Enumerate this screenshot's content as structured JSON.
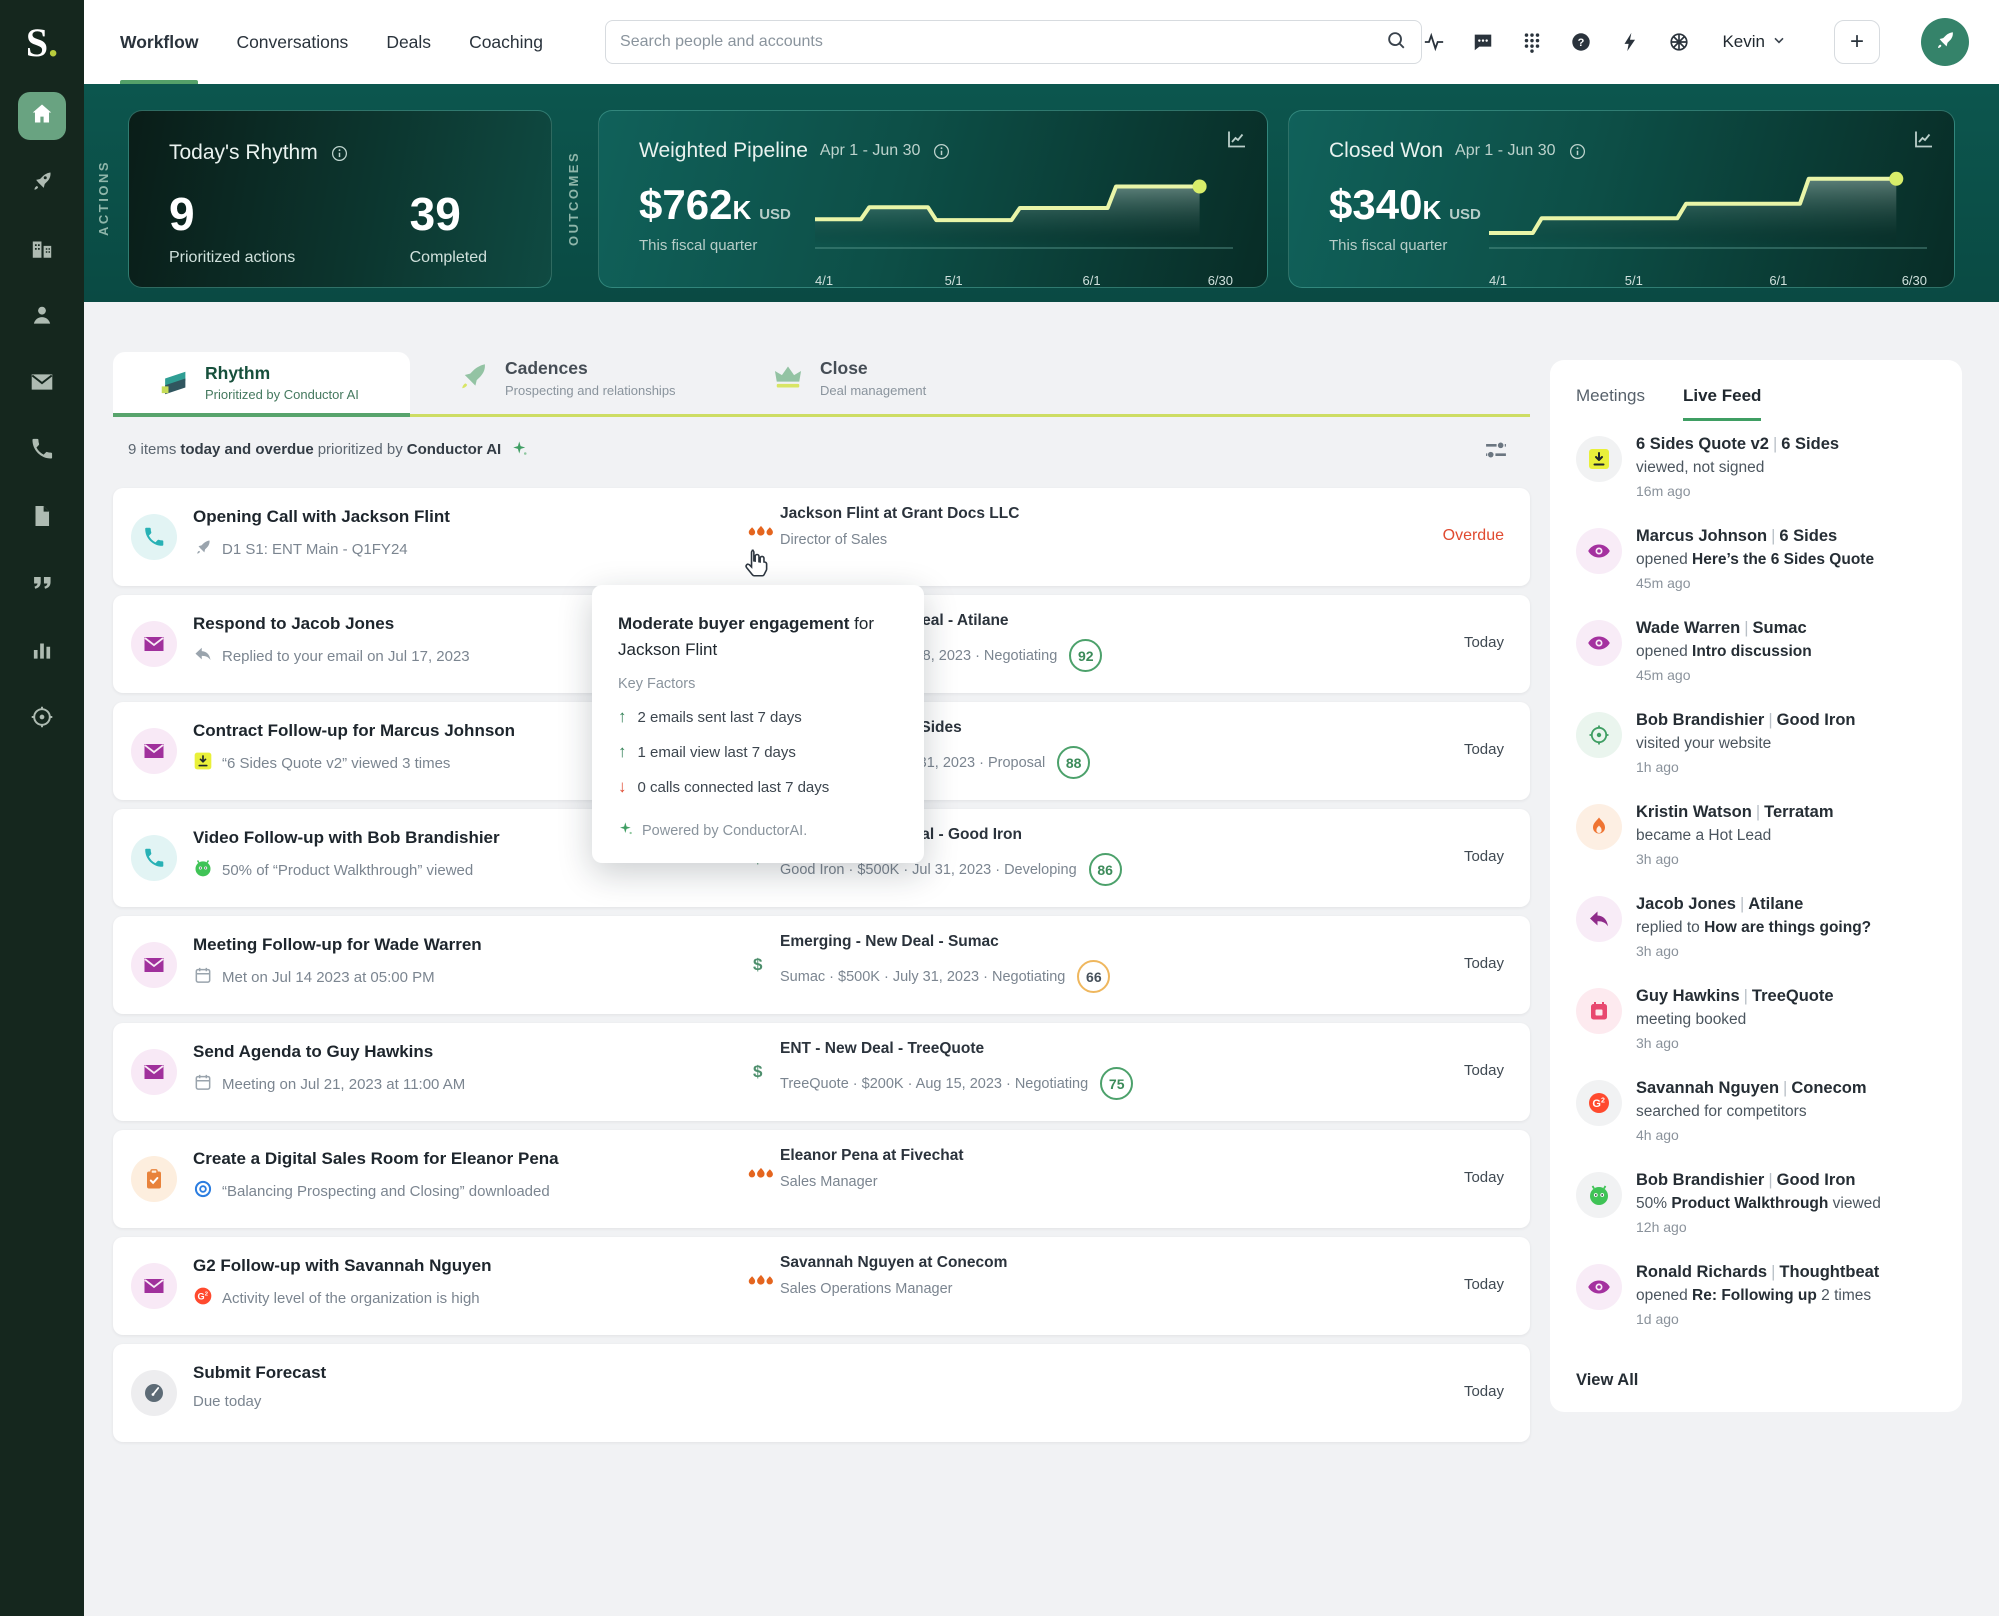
{
  "colors": {
    "brand_green": "#69a381",
    "teal_band": "#0b524b",
    "accent_lime": "#cddd63",
    "active_underline": "#58a46c",
    "overdue_red": "#e04b31",
    "score_green": "#4ca16b",
    "score_amber": "#efb75e",
    "spark_line": "#e9f5a8",
    "flame_orange": "#e4651f"
  },
  "sidebar": {
    "logo_s": "S",
    "logo_dot": "."
  },
  "topnav": {
    "links": [
      "Workflow",
      "Conversations",
      "Deals",
      "Coaching"
    ],
    "active_link": "Workflow",
    "search_placeholder": "Search people and accounts",
    "user_name": "Kevin",
    "add_label": "+"
  },
  "band": {
    "actions_label": "ACTIONS",
    "outcomes_label": "OUTCOMES",
    "rhythm": {
      "title": "Today's Rhythm",
      "stat1": "9",
      "stat1_label": "Prioritized actions",
      "stat2": "39",
      "stat2_label": "Completed"
    },
    "pipeline": {
      "title": "Weighted Pipeline",
      "period": "Apr 1 - Jun 30",
      "value": "$762",
      "suffix": "K",
      "currency": "USD",
      "caption": "This fiscal quarter"
    },
    "closed": {
      "title": "Closed Won",
      "period": "Apr 1 - Jun 30",
      "value": "$340",
      "suffix": "K",
      "currency": "USD",
      "caption": "This fiscal quarter"
    }
  },
  "chart_data": [
    {
      "type": "area-step",
      "title": "Weighted Pipeline",
      "value_label": "$762K USD",
      "period": "Apr 1 - Jun 30",
      "x_ticks": [
        "4/1",
        "5/1",
        "6/1",
        "6/30"
      ],
      "points": [
        [
          0,
          70
        ],
        [
          11,
          70
        ],
        [
          13,
          56
        ],
        [
          27,
          56
        ],
        [
          29,
          71
        ],
        [
          47,
          71
        ],
        [
          49,
          57
        ],
        [
          70,
          57
        ],
        [
          72,
          32
        ],
        [
          92,
          32
        ]
      ]
    },
    {
      "type": "area-step",
      "title": "Closed Won",
      "value_label": "$340K USD",
      "period": "Apr 1 - Jun 30",
      "x_ticks": [
        "4/1",
        "5/1",
        "6/1",
        "6/30"
      ],
      "points": [
        [
          0,
          86
        ],
        [
          10,
          86
        ],
        [
          12,
          69
        ],
        [
          43,
          69
        ],
        [
          45,
          52
        ],
        [
          71,
          52
        ],
        [
          73,
          23
        ],
        [
          93,
          23
        ]
      ]
    }
  ],
  "tabs": [
    {
      "title": "Rhythm",
      "subtitle": "Prioritized by Conductor AI"
    },
    {
      "title": "Cadences",
      "subtitle": "Prospecting and relationships"
    },
    {
      "title": "Close",
      "subtitle": "Deal management"
    }
  ],
  "list_header": {
    "pre": "9 items ",
    "bold1": "today and overdue",
    "mid": " prioritized by ",
    "bold2": "Conductor AI"
  },
  "tasks": [
    {
      "title": "Opening Call with Jackson Flint",
      "sub": "D1 S1: ENT Main - Q1FY24",
      "m1": "Jackson Flint at Grant Docs LLC",
      "m2": "Director of Sales",
      "status": "Overdue"
    },
    {
      "title": "Respond to Jacob Jones",
      "sub": "Replied to your email on Jul 17, 2023",
      "m1": "Mid Market - New Deal - Atilane",
      "m2": "Atilane · $450K · Jul 28, 2023 · Negotiating",
      "score": "92",
      "status": "Today"
    },
    {
      "title": "Contract Follow-up for Marcus Johnson",
      "sub": "“6 Sides Quote v2” viewed 3 times",
      "m1": "ENT - New Deal - 6 Sides",
      "m2": "6 Sides · $300K · Jul 31, 2023 · Proposal",
      "score": "88",
      "status": "Today"
    },
    {
      "title": "Video Follow-up with Bob Brandishier",
      "sub": "50% of “Product Walkthrough” viewed",
      "m1": "Emerging - New Deal - Good Iron",
      "m2": "Good Iron · $500K · Jul 31, 2023 · Developing",
      "score": "86",
      "status": "Today"
    },
    {
      "title": "Meeting Follow-up for Wade Warren",
      "sub": "Met on Jul 14 2023 at 05:00 PM",
      "m1": "Emerging - New Deal - Sumac",
      "m2": "Sumac · $500K · July 31, 2023 · Negotiating",
      "score": "66",
      "status": "Today"
    },
    {
      "title": "Send Agenda to Guy Hawkins",
      "sub": "Meeting on Jul 21, 2023 at 11:00 AM",
      "m1": "ENT - New Deal - TreeQuote",
      "m2": "TreeQuote · $200K · Aug 15, 2023 · Negotiating",
      "score": "75",
      "status": "Today"
    },
    {
      "title": "Create a Digital Sales Room for Eleanor Pena",
      "sub": "“Balancing Prospecting and Closing” downloaded",
      "m1": "Eleanor Pena at Fivechat",
      "m2": "Sales Manager",
      "status": "Today"
    },
    {
      "title": "G2 Follow-up with Savannah Nguyen",
      "sub": "Activity level of the organization is high",
      "m1": "Savannah Nguyen at Conecom",
      "m2": "Sales Operations Manager",
      "status": "Today"
    },
    {
      "title": "Submit Forecast",
      "sub": "Due today",
      "status": "Today"
    }
  ],
  "tooltip": {
    "line1_bold": "Moderate buyer engagement",
    "line1_rest": " for Jackson Flint",
    "factors_label": "Key Factors",
    "f1": "2 emails sent last 7 days",
    "f2": "1 email view last 7 days",
    "f3": "0 calls connected last 7 days",
    "footer": "Powered by ConductorAI."
  },
  "feed": {
    "tab1": "Meetings",
    "tab2": "Live Feed",
    "view_all": "View All",
    "items": [
      {
        "name": "6 Sides Quote v2",
        "company": "6 Sides",
        "pre": "viewed, not signed",
        "bold": "",
        "post": "",
        "time": "16m ago"
      },
      {
        "name": "Marcus Johnson",
        "company": "6 Sides",
        "pre": "opened ",
        "bold": "Here’s the 6 Sides Quote",
        "post": "",
        "time": "45m ago"
      },
      {
        "name": "Wade Warren",
        "company": "Sumac",
        "pre": "opened ",
        "bold": "Intro discussion",
        "post": "",
        "time": "45m ago"
      },
      {
        "name": "Bob Brandishier",
        "company": "Good Iron",
        "pre": "visited your website",
        "bold": "",
        "post": "",
        "time": "1h ago"
      },
      {
        "name": "Kristin Watson",
        "company": "Terratam",
        "pre": "became a Hot Lead",
        "bold": "",
        "post": "",
        "time": "3h ago"
      },
      {
        "name": "Jacob Jones",
        "company": "Atilane",
        "pre": "replied to ",
        "bold": "How are things going?",
        "post": "",
        "time": "3h ago"
      },
      {
        "name": "Guy Hawkins",
        "company": "TreeQuote",
        "pre": "meeting booked",
        "bold": "",
        "post": "",
        "time": "3h ago"
      },
      {
        "name": "Savannah Nguyen",
        "company": "Conecom",
        "pre": "searched for competitors",
        "bold": "",
        "post": "",
        "time": "4h ago"
      },
      {
        "name": "Bob Brandishier",
        "company": "Good Iron",
        "pre": "50% ",
        "bold": "Product Walkthrough",
        "post": " viewed",
        "time": "12h ago"
      },
      {
        "name": "Ronald Richards",
        "company": "Thoughtbeat",
        "pre": "opened ",
        "bold": "Re: Following up",
        "post": " 2 times",
        "time": "1d ago"
      }
    ]
  }
}
